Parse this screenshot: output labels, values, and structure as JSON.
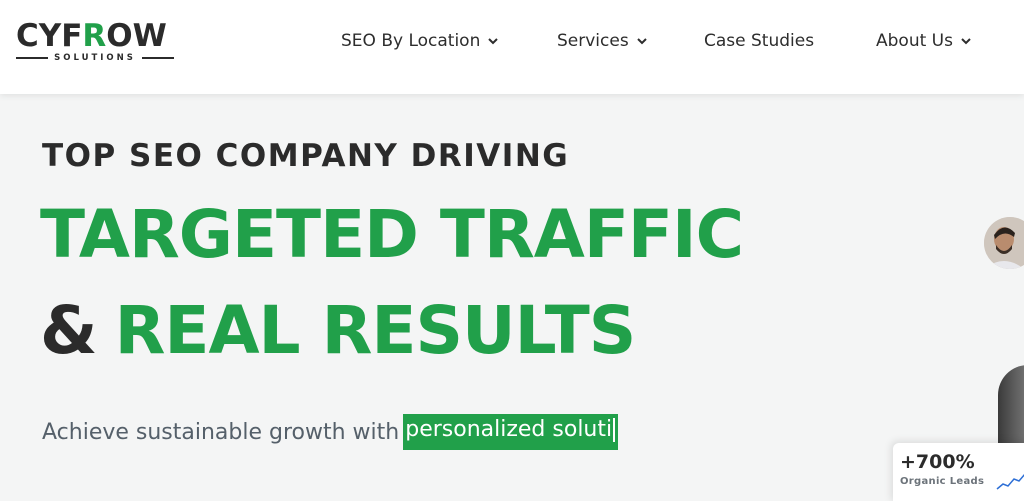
{
  "brand": {
    "logo_prefix": "CY",
    "logo_mid": "F",
    "logo_accent": "R",
    "logo_suffix": "OW",
    "logo_sub": "SOLUTIONS"
  },
  "nav": {
    "items": [
      {
        "label": "SEO By Location",
        "icon": "chevron-down-icon"
      },
      {
        "label": "Services",
        "icon": "chevron-down-icon"
      },
      {
        "label": "Case Studies"
      },
      {
        "label": "About Us",
        "icon": "chevron-down-icon"
      }
    ]
  },
  "hero": {
    "kicker": "TOP SEO COMPANY DRIVING",
    "line1": "TARGETED TRAFFIC",
    "line2_amp": "&",
    "line2": "REAL RESULTS",
    "sub_static": "Achieve sustainable growth with",
    "sub_typed": "personalized soluti"
  },
  "stat": {
    "value": "+700%",
    "label": "Organic Leads"
  },
  "colors": {
    "brand_green": "#21a04a",
    "text_dark": "#2b2b2b",
    "background": "#f4f5f5"
  }
}
